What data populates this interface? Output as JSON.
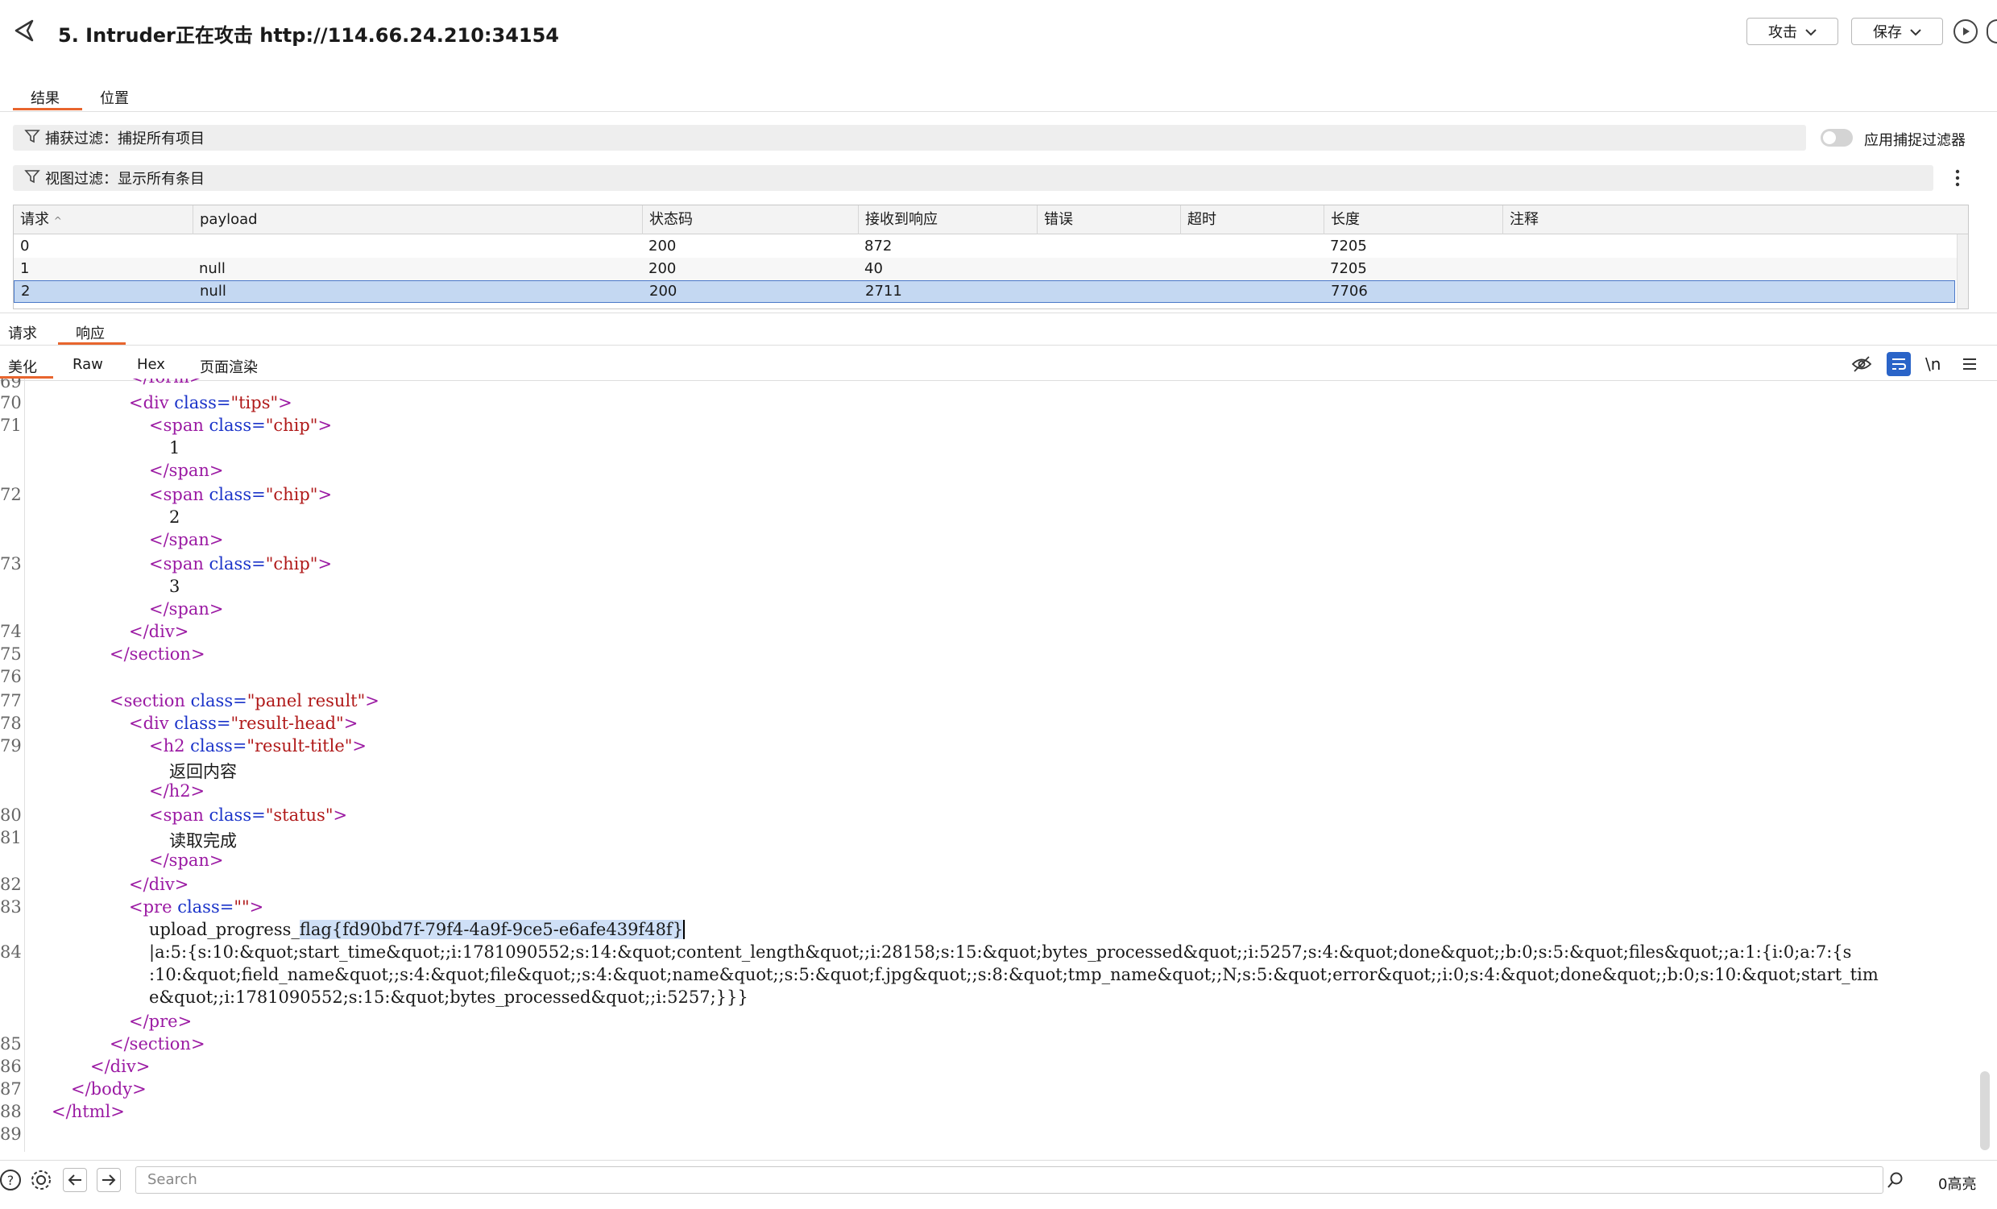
{
  "window": {
    "title": "5. Intruder正在攻击 http://114.66.24.210:34154"
  },
  "header": {
    "attack_label": "攻击",
    "save_label": "保存"
  },
  "main_tabs": [
    {
      "label": "结果",
      "active": true
    },
    {
      "label": "位置",
      "active": false
    }
  ],
  "capture_filter": {
    "text": "捕获过滤：捕捉所有项目",
    "toggle_label": "应用捕捉过滤器",
    "toggle_on": false
  },
  "view_filter": {
    "text": "视图过滤：显示所有条目"
  },
  "table": {
    "columns": [
      "请求",
      "payload",
      "状态码",
      "接收到响应",
      "错误",
      "超时",
      "长度",
      "注释"
    ],
    "rows": [
      {
        "request": "0",
        "payload": "",
        "status": "200",
        "received": "872",
        "error": "",
        "timeout": "",
        "length": "7205",
        "comment": ""
      },
      {
        "request": "1",
        "payload": "null",
        "status": "200",
        "received": "40",
        "error": "",
        "timeout": "",
        "length": "7205",
        "comment": ""
      },
      {
        "request": "2",
        "payload": "null",
        "status": "200",
        "received": "2711",
        "error": "",
        "timeout": "",
        "length": "7706",
        "comment": "",
        "selected": true
      }
    ]
  },
  "detail_tabs": [
    {
      "label": "请求",
      "active": false
    },
    {
      "label": "响应",
      "active": true
    }
  ],
  "view_tabs": [
    {
      "label": "美化",
      "active": true
    },
    {
      "label": "Raw"
    },
    {
      "label": "Hex"
    },
    {
      "label": "页面渲染"
    }
  ],
  "view_tools": {
    "newline_label": "\\n"
  },
  "editor": {
    "line_numbers": [
      "69",
      "70",
      "71",
      "72",
      "73",
      "74",
      "75",
      "76",
      "77",
      "78",
      "79",
      "80",
      "81",
      "82",
      "83",
      "84",
      "85",
      "86",
      "87",
      "88",
      "89"
    ],
    "flag_prefix": "upload_progress_",
    "flag_value": "flag{fd90bd7f-79f4-4a9f-9ce5-e6afe439f48f}",
    "serialized_1": "|a:5:{s:10:&quot;start_time&quot;;i:1781090552;s:14:&quot;content_length&quot;;i:28158;s:15:&quot;bytes_processed&quot;;i:5257;s:4:&quot;done&quot;;b:0;s:5:&quot;files&quot;;a:1:{i:0;a:7:{s",
    "serialized_2": ":10:&quot;field_name&quot;;s:4:&quot;file&quot;;s:4:&quot;name&quot;;s:5:&quot;f.jpg&quot;;s:8:&quot;tmp_name&quot;;N;s:5:&quot;error&quot;;i:0;s:4:&quot;done&quot;;b:0;s:10:&quot;start_tim",
    "serialized_3": "e&quot;;i:1781090552;s:15:&quot;bytes_processed&quot;;i:5257;}}}",
    "text_result_title": "返回内容",
    "text_status": "读取完成"
  },
  "bottom": {
    "search_placeholder": "Search",
    "highlight_count": "0高亮"
  },
  "colors": {
    "accent": "#e8652e",
    "selected_row": "#c4d8f2",
    "tag": "#9b1aa3",
    "attr": "#1a33c9",
    "value": "#b01919"
  }
}
